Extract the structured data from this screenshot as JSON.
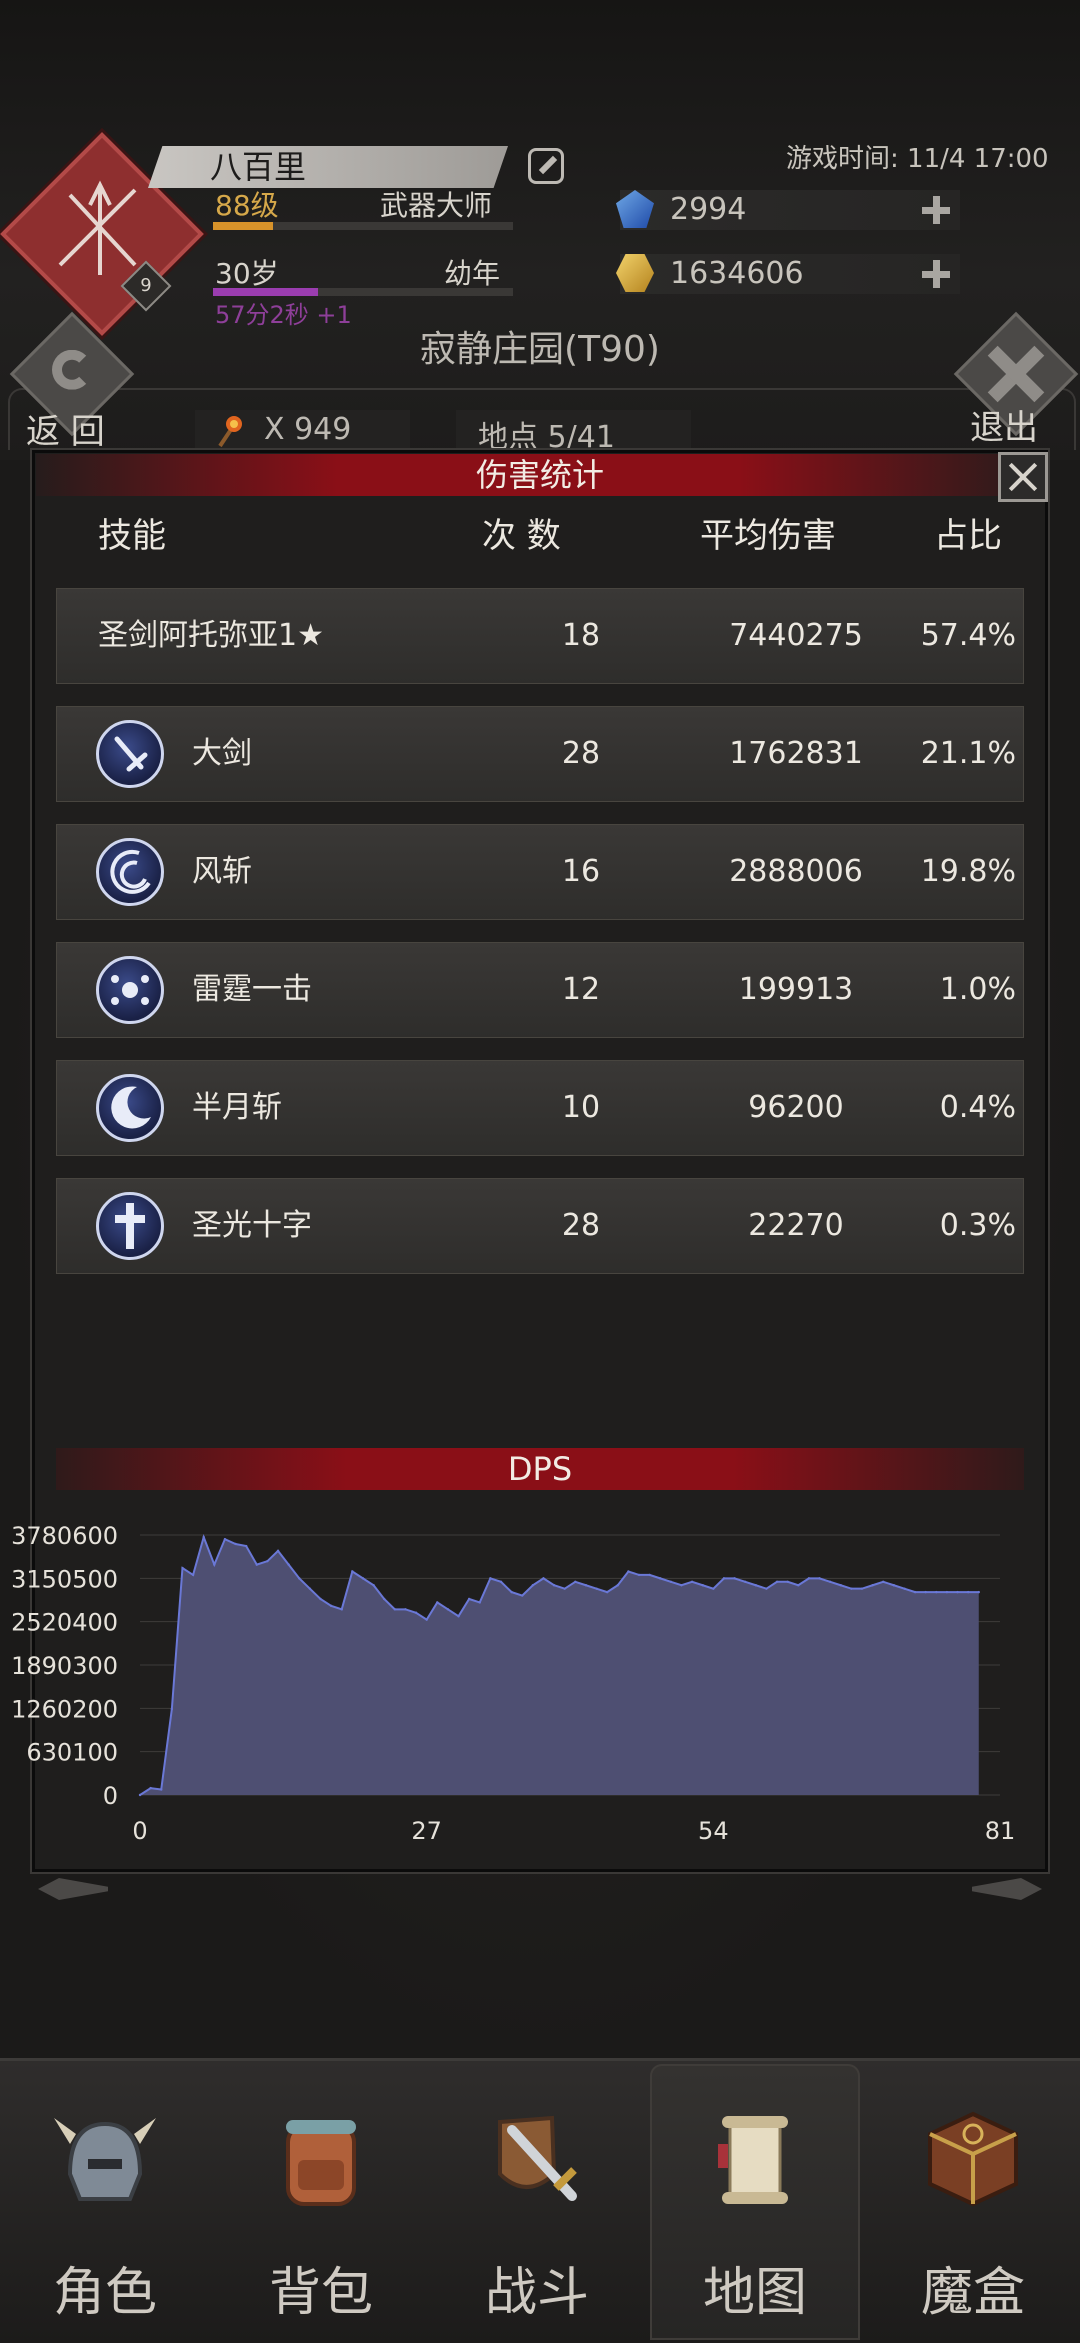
{
  "header": {
    "name": "八百里",
    "level": "88级",
    "class": "武器大师",
    "age": "30岁",
    "stage": "幼年",
    "timer": "57分2秒 +1",
    "badge_number": "9",
    "game_time": "游戏时间: 11/4 17:00",
    "level_progress": 0.2,
    "age_progress": 0.35
  },
  "resources": {
    "blue_gems": "2994",
    "gold": "1634606"
  },
  "location": {
    "name": "寂静庄园(T90)",
    "back_label": "返 回",
    "exit_label": "退出",
    "torch_count": "X 949",
    "spot": "地点 5/41"
  },
  "modal": {
    "title": "伤害统计",
    "headers": {
      "skill": "技能",
      "count": "次 数",
      "avg": "平均伤害",
      "pct": "占比"
    },
    "rows": [
      {
        "name": "圣剑阿托弥亚1★",
        "count": "18",
        "avg": "7440275",
        "pct": "57.4%",
        "icon": ""
      },
      {
        "name": "大剑",
        "count": "28",
        "avg": "1762831",
        "pct": "21.1%",
        "icon": "sword-icon"
      },
      {
        "name": "风斩",
        "count": "16",
        "avg": "2888006",
        "pct": "19.8%",
        "icon": "wind-slash-icon"
      },
      {
        "name": "雷霆一击",
        "count": "12",
        "avg": "199913",
        "pct": "1.0%",
        "icon": "thunder-icon"
      },
      {
        "name": "半月斩",
        "count": "10",
        "avg": "96200",
        "pct": "0.4%",
        "icon": "half-moon-icon"
      },
      {
        "name": "圣光十字",
        "count": "28",
        "avg": "22270",
        "pct": "0.3%",
        "icon": "holy-cross-icon"
      }
    ]
  },
  "dps_title": "DPS",
  "chart_data": {
    "type": "area",
    "title": "DPS",
    "color": "#4e4f72",
    "line_color": "#6a78d6",
    "xlim": [
      0,
      81
    ],
    "ylim": [
      0,
      3780600
    ],
    "x_ticks": [
      "0",
      "27",
      "54",
      "81"
    ],
    "y_ticks": [
      "3780600",
      "3150500",
      "2520400",
      "1890300",
      "1260200",
      "630100",
      "0"
    ],
    "x": [
      0,
      1,
      2,
      3,
      4,
      5,
      6,
      7,
      8,
      9,
      10,
      11,
      12,
      13,
      14,
      15,
      16,
      17,
      18,
      19,
      20,
      21,
      22,
      23,
      24,
      25,
      26,
      27,
      28,
      29,
      30,
      31,
      32,
      33,
      34,
      35,
      36,
      37,
      38,
      39,
      40,
      41,
      42,
      43,
      44,
      45,
      46,
      47,
      48,
      49,
      50,
      51,
      52,
      53,
      54,
      55,
      56,
      57,
      58,
      59,
      60,
      61,
      62,
      63,
      64,
      65,
      66,
      67,
      68,
      69,
      70,
      71,
      72,
      73,
      74,
      75,
      76,
      77,
      78,
      79
    ],
    "values": [
      0,
      100000,
      80000,
      1250000,
      3300000,
      3200000,
      3750000,
      3350000,
      3720000,
      3650000,
      3620000,
      3350000,
      3400000,
      3550000,
      3350000,
      3150000,
      3000000,
      2850000,
      2750000,
      2700000,
      3250000,
      3150000,
      3050000,
      2850000,
      2700000,
      2700000,
      2650000,
      2550000,
      2800000,
      2700000,
      2600000,
      2850000,
      2800000,
      3150000,
      3100000,
      2950000,
      2900000,
      3050000,
      3150000,
      3050000,
      3000000,
      3100000,
      3050000,
      3000000,
      2950000,
      3050000,
      3250000,
      3200000,
      3200000,
      3150000,
      3100000,
      3050000,
      3100000,
      3050000,
      3000000,
      3150000,
      3150000,
      3100000,
      3050000,
      3000000,
      3100000,
      3100000,
      3050000,
      3150000,
      3150000,
      3100000,
      3050000,
      3000000,
      3000000,
      3050000,
      3100000,
      3050000,
      3000000,
      2950000,
      2950000,
      2950000,
      2950000,
      2950000,
      2950000,
      2950000
    ]
  },
  "bottom_nav": [
    {
      "label": "角色",
      "icon": "helmet-icon"
    },
    {
      "label": "背包",
      "icon": "backpack-icon"
    },
    {
      "label": "战斗",
      "icon": "sword-shield-icon"
    },
    {
      "label": "地图",
      "icon": "map-scroll-icon",
      "active": true
    },
    {
      "label": "魔盒",
      "icon": "magic-box-icon"
    }
  ]
}
